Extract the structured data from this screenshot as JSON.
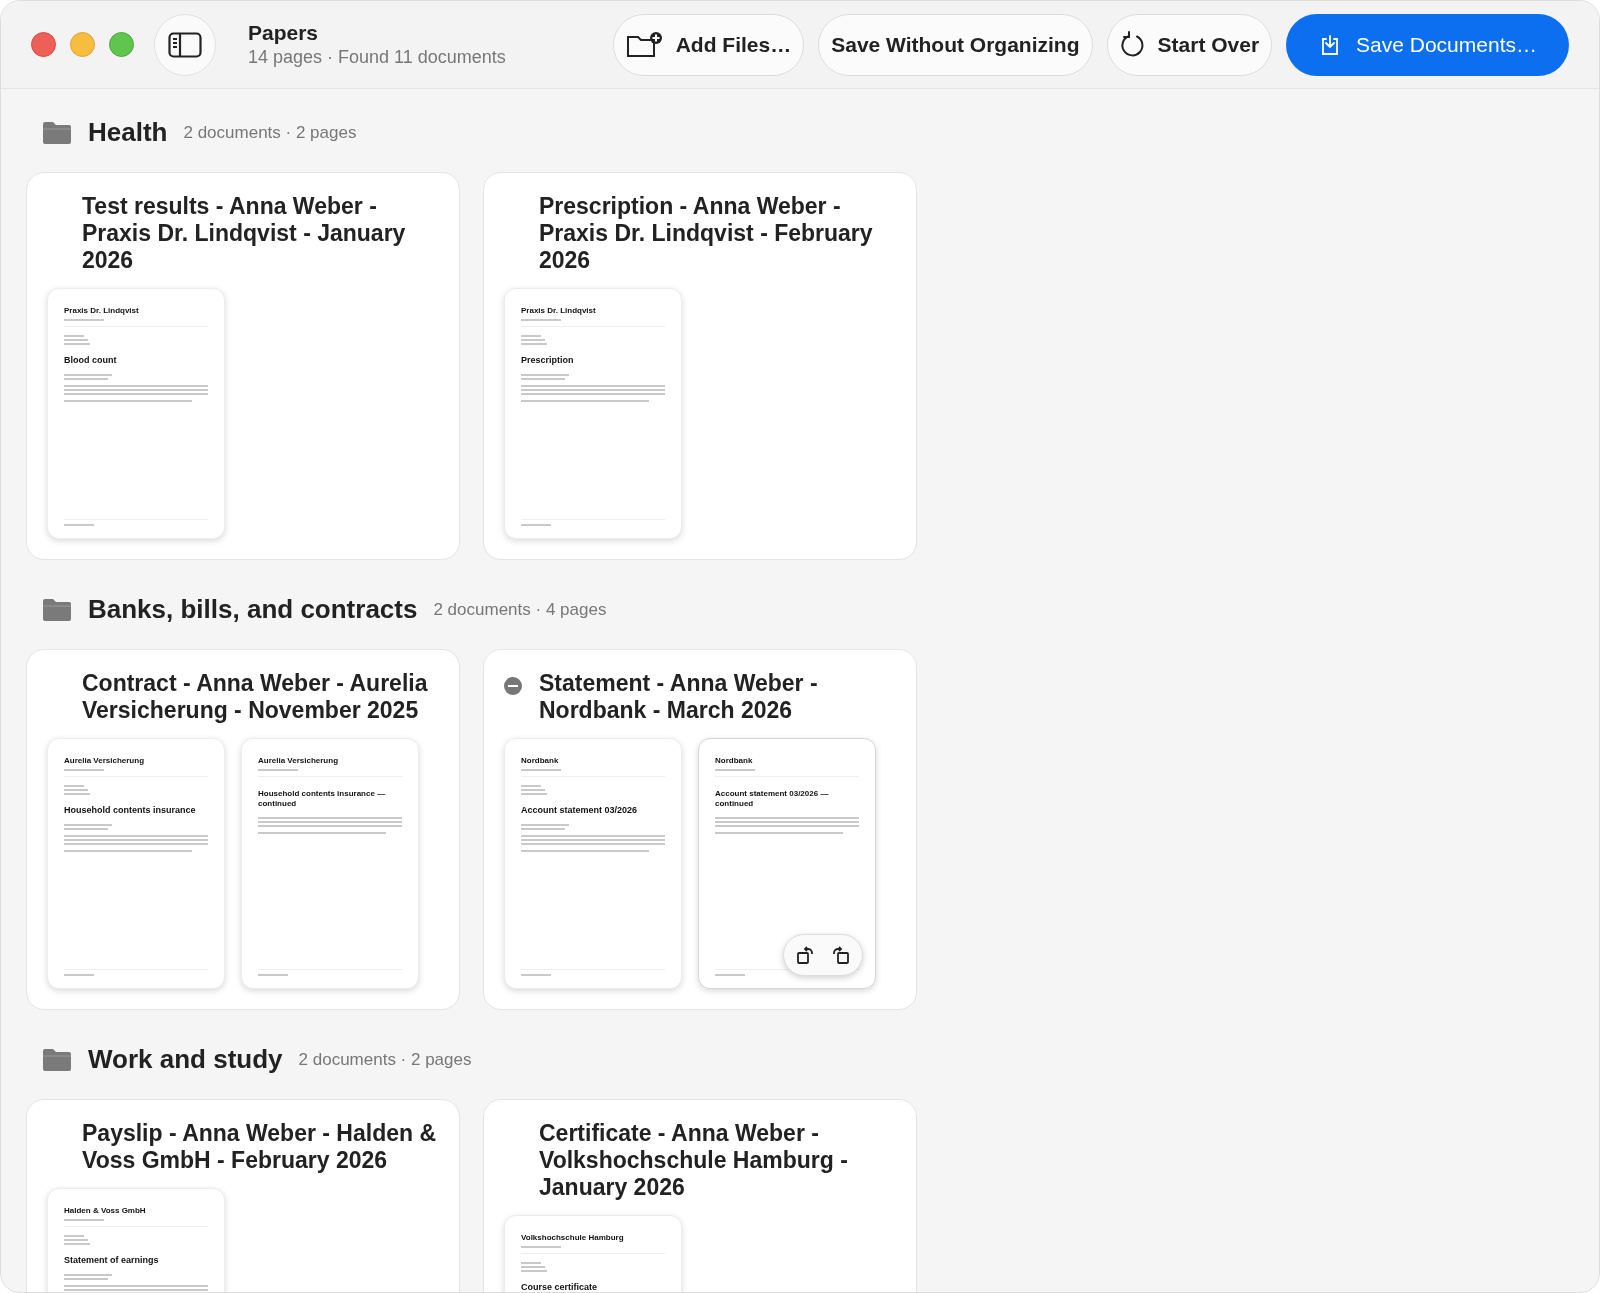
{
  "window": {
    "title": "Papers",
    "subtitle": "14 pages · Found 11 documents"
  },
  "toolbar": [
    {
      "kind": "add",
      "label": "Add Files…"
    },
    {
      "kind": "plain",
      "label": "Save Without Organizing"
    },
    {
      "kind": "restart",
      "label": "Start Over"
    },
    {
      "kind": "save",
      "label": "Save Documents…"
    }
  ],
  "sections": [
    {
      "title": "Health",
      "meta": "2 documents · 2 pages",
      "documents": [
        {
          "title": "Test results - Anna Weber - Praxis Dr. Lindqvist - January 2026",
          "hovered": false,
          "pages": [
            {
              "kind": "first",
              "sender": "Praxis Dr. Lindqvist",
              "heading": "Blood count",
              "hovered": false
            }
          ]
        },
        {
          "title": "Prescription - Anna Weber - Praxis Dr. Lindqvist - February 2026",
          "hovered": false,
          "pages": [
            {
              "kind": "first",
              "sender": "Praxis Dr. Lindqvist",
              "heading": "Prescription",
              "hovered": false
            }
          ]
        }
      ]
    },
    {
      "title": "Banks, bills, and contracts",
      "meta": "2 documents · 4 pages",
      "documents": [
        {
          "title": "Contract - Anna Weber - Aurelia Versicherung - November 2025",
          "hovered": false,
          "pages": [
            {
              "kind": "first",
              "sender": "Aurelia Versicherung",
              "heading": "Household contents insurance",
              "hovered": false
            },
            {
              "kind": "continued",
              "sender": "Aurelia Versicherung",
              "heading": "Household contents insurance — continued",
              "hovered": false
            }
          ]
        },
        {
          "title": "Statement - Anna Weber - Nordbank - March 2026",
          "hovered": true,
          "pages": [
            {
              "kind": "first",
              "sender": "Nordbank",
              "heading": "Account statement 03/2026",
              "hovered": false
            },
            {
              "kind": "continued",
              "sender": "Nordbank",
              "heading": "Account statement 03/2026 — continued",
              "hovered": true
            }
          ]
        }
      ]
    },
    {
      "title": "Work and study",
      "meta": "2 documents · 2 pages",
      "documents": [
        {
          "title": "Payslip - Anna Weber - Halden & Voss GmbH - February 2026",
          "hovered": false,
          "pages": [
            {
              "kind": "first",
              "sender": "Halden & Voss GmbH",
              "heading": "Statement of earnings",
              "hovered": false
            }
          ]
        },
        {
          "title": "Certificate - Anna Weber - Volkshochschule Hamburg - January 2026",
          "hovered": false,
          "pages": [
            {
              "kind": "first",
              "sender": "Volkshochschule Hamburg",
              "heading": "Course certificate",
              "hovered": false
            }
          ]
        }
      ]
    }
  ]
}
